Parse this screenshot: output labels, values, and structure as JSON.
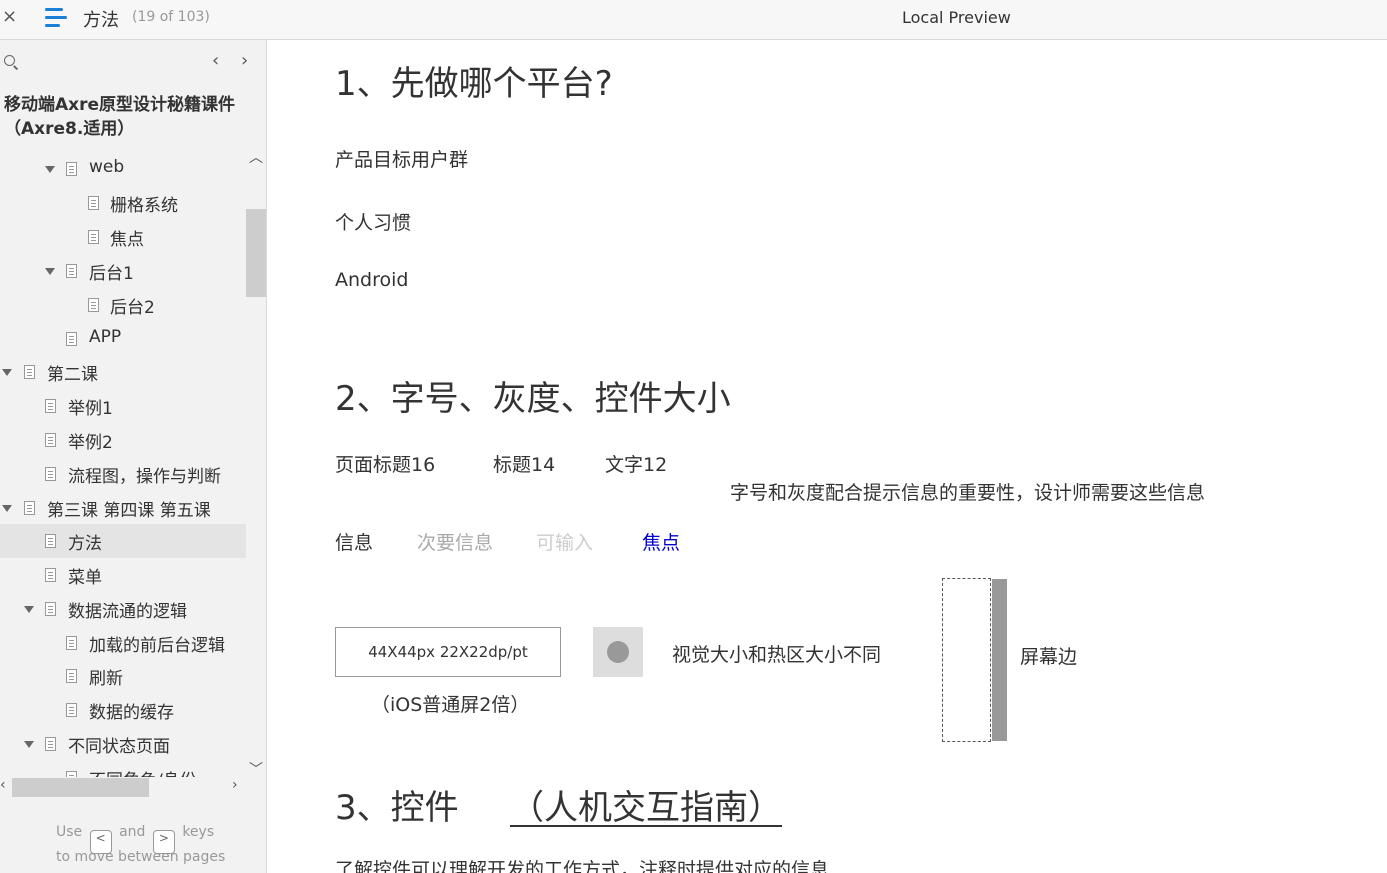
{
  "topbar": {
    "close_glyph": "×",
    "page_name": "方法",
    "page_count": "(19 of 103)",
    "preview_title": "Local Preview"
  },
  "sidebar": {
    "prev_glyph": "‹",
    "next_glyph": "›",
    "project_title": "移动端Axre原型设计秘籍课件（Axre8.适用）",
    "items": [
      {
        "label": "web",
        "expanded": true
      },
      {
        "label": "栅格系统"
      },
      {
        "label": "焦点"
      },
      {
        "label": "后台1",
        "expanded": true
      },
      {
        "label": "后台2"
      },
      {
        "label": "APP"
      },
      {
        "label": "第二课",
        "expanded": true
      },
      {
        "label": "举例1"
      },
      {
        "label": "举例2"
      },
      {
        "label": "流程图，操作与判断"
      },
      {
        "label": "第三课 第四课 第五课",
        "expanded": true
      },
      {
        "label": "方法",
        "selected": true
      },
      {
        "label": "菜单"
      },
      {
        "label": "数据流通的逻辑",
        "expanded": true
      },
      {
        "label": "加载的前后台逻辑"
      },
      {
        "label": "刷新"
      },
      {
        "label": "数据的缓存"
      },
      {
        "label": "不同状态页面",
        "expanded": true
      },
      {
        "label": "不同角色/身份"
      }
    ],
    "hint": {
      "use": "Use",
      "key_prev": "<",
      "and": "and",
      "key_next": ">",
      "keys": "keys",
      "line2": "to move between pages"
    }
  },
  "content": {
    "h1": "1、先做哪个平台?",
    "p1": "产品目标用户群",
    "p2": "个人习惯",
    "p3": "Android",
    "h2": "2、字号、灰度、控件大小",
    "font_title": "页面标题16",
    "font_heading": "标题14",
    "font_text": "文字12",
    "font_note": "字号和灰度配合提示信息的重要性，设计师需要这些信息",
    "info": "信息",
    "info_secondary": "次要信息",
    "info_input": "可输入",
    "info_focus": "焦点",
    "size_box": "44X44px   22X22dp/pt",
    "size_note": "（iOS普通屏2倍）",
    "hotzone_note": "视觉大小和热区大小不同",
    "screen_edge": "屏幕边",
    "h3": "3、控件",
    "h3_link": "（人机交互指南）",
    "p_bottom": "了解控件可以理解开发的工作方式，注释时提供对应的信息"
  }
}
